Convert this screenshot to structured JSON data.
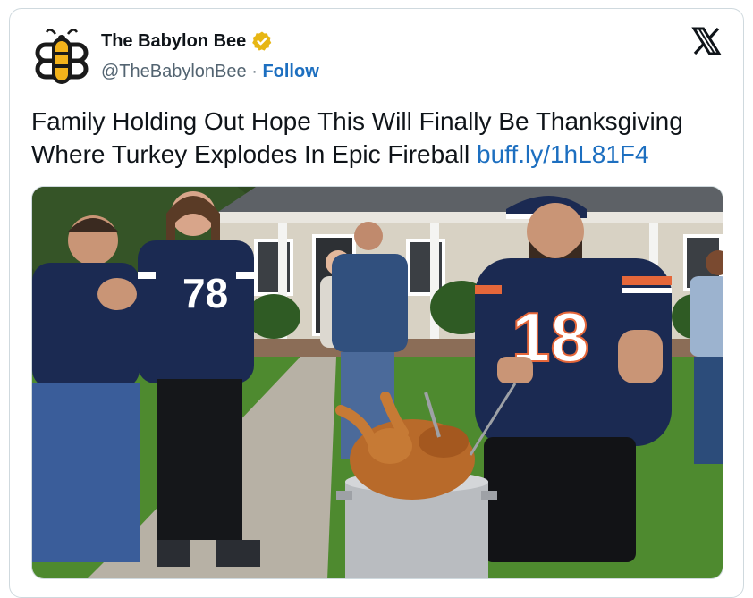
{
  "tweet": {
    "author": {
      "display_name": "The Babylon Bee",
      "handle": "@TheBabylonBee",
      "separator": "·",
      "follow_label": "Follow",
      "avatar_icon": "bee-logo-icon",
      "verified_icon": "verified-badge-icon",
      "verified_color": "#e7b614"
    },
    "platform_icon": "x-logo-icon",
    "text": "Family Holding Out Hope This Will Finally Be Thanksgiving Where Turkey Explodes In Epic Fireball",
    "link": "buff.ly/1hL81F4",
    "media": {
      "jersey_number_left": "78",
      "jersey_number_right": "18",
      "colors": {
        "jersey": "#1b2a52",
        "stripe": "#e5673a",
        "grass": "#4e8a2f",
        "house": "#d8d2c4",
        "turkey": "#b86a2a",
        "pot": "#b9bcc0"
      }
    }
  }
}
